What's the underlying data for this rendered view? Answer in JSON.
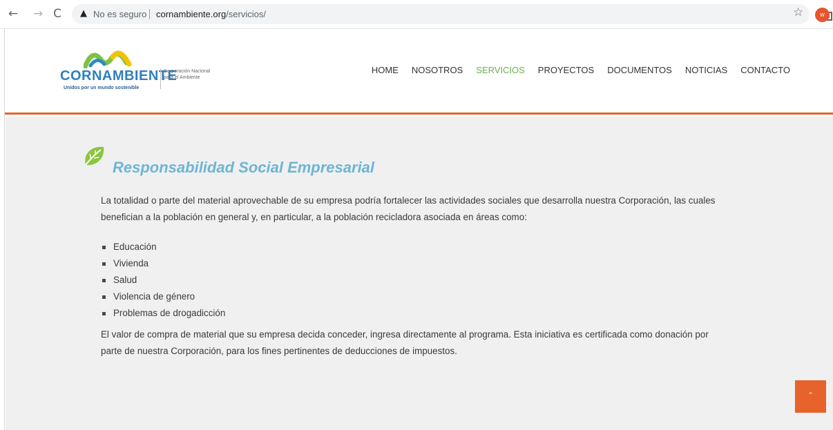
{
  "browser": {
    "back_icon": "←",
    "forward_icon": "→",
    "reload_icon": "C",
    "security_icon": "▲",
    "security_label": "No es seguro",
    "url_host": "cornambiente.org",
    "url_path": "/servicios/",
    "star_icon": "☆",
    "avatar_letter": "w"
  },
  "logo": {
    "word": "CORNAMBIENTE",
    "tagline": "Unidos por un mundo sostenible",
    "side_text": "Corporación Nacional para el Ambiente"
  },
  "nav": {
    "items": [
      "HOME",
      "NOSOTROS",
      "SERVICIOS",
      "PROYECTOS",
      "DOCUMENTOS",
      "NOTICIAS",
      "CONTACTO"
    ],
    "active": "SERVICIOS"
  },
  "content": {
    "heading": "Responsabilidad Social Empresarial",
    "intro": "La totalidad o parte del material aprovechable de su empresa podría fortalecer las actividades sociales que desarrolla nuestra Corporación, las cuales benefician a la población en general y, en particular, a la población recicladora asociada en áreas como:",
    "bullets": [
      "Educación",
      "Vivienda",
      "Salud",
      "Violencia de género",
      "Problemas de drogadicción"
    ],
    "closing": "El  valor de compra de material que su empresa decida conceder, ingresa directamente al programa. Esta iniciativa es certificada como donación por parte de nuestra Corporación, para los fines pertinentes de deducciones de impuestos."
  },
  "scroll_top_icon": "˄",
  "colors": {
    "accent_orange": "#e8622c",
    "heading_blue": "#6db5d4",
    "nav_active_green": "#6ab04c"
  }
}
